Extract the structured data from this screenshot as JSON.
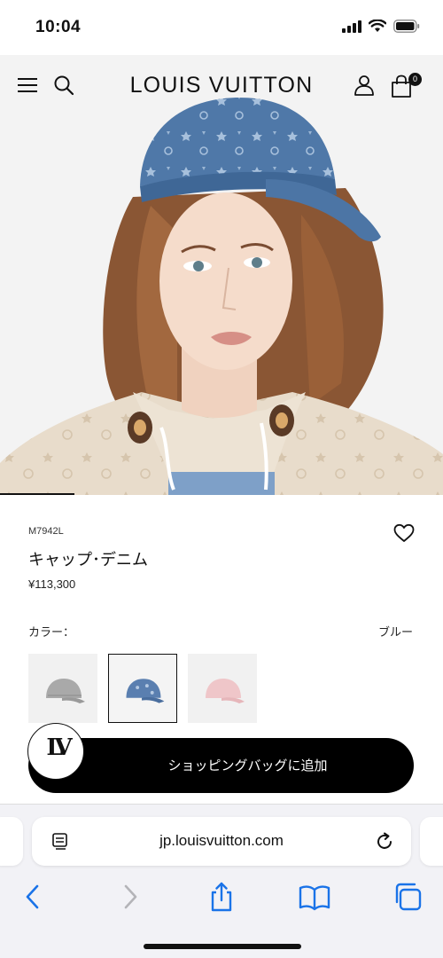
{
  "status_bar": {
    "time": "10:04"
  },
  "header": {
    "brand": "LOUIS VUITTON",
    "bag_count": "0",
    "icons": [
      "menu-icon",
      "search-icon",
      "account-icon",
      "shopping-bag-icon"
    ]
  },
  "product": {
    "sku": "M7942L",
    "name": "キャップ･デニム",
    "price": "¥113,300",
    "color_label": "カラー：",
    "color_value": "ブルー",
    "swatches": [
      {
        "color": "#a9a9a9",
        "selected": false
      },
      {
        "color": "#5a7fb0",
        "selected": true
      },
      {
        "color": "#efc6c9",
        "selected": false
      }
    ],
    "add_to_bag": "ショッピングバッグに追加"
  },
  "browser": {
    "url": "jp.louisvuitton.com",
    "accent": "#1a73e8",
    "toolbar_icons": [
      "back-icon",
      "forward-icon",
      "share-icon",
      "bookmarks-icon",
      "tabs-icon"
    ]
  }
}
